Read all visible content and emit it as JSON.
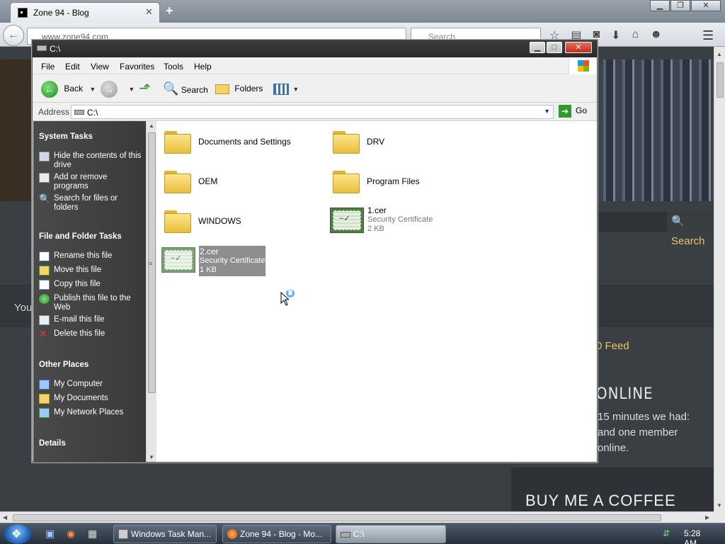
{
  "browser": {
    "tab_title": "Zone 94 - Blog",
    "url": "www.zone94.com",
    "search_placeholder": "Search",
    "window_controls": [
      "minimize",
      "maximize",
      "close"
    ]
  },
  "webpage": {
    "search_button": "Search",
    "you_text": "You",
    "feed_text": "0 Feed",
    "online_heading": "ONLINE",
    "stats_lines": [
      "15 minutes we had:",
      "and one member",
      "online."
    ],
    "coffee_heading": "BUY ME A COFFEE"
  },
  "explorer": {
    "title": "C:\\",
    "menu": [
      "File",
      "Edit",
      "View",
      "Favorites",
      "Tools",
      "Help"
    ],
    "toolbar": {
      "back": "Back",
      "search": "Search",
      "folders": "Folders"
    },
    "address": {
      "label": "Address",
      "value": "C:\\",
      "go": "Go"
    },
    "task_pane": {
      "system_tasks": {
        "heading": "System Tasks",
        "items": [
          "Hide the contents of this drive",
          "Add or remove programs",
          "Search for files or folders"
        ]
      },
      "file_folder_tasks": {
        "heading": "File and Folder Tasks",
        "items": [
          "Rename this file",
          "Move this file",
          "Copy this file",
          "Publish this file to the Web",
          "E-mail this file",
          "Delete this file"
        ]
      },
      "other_places": {
        "heading": "Other Places",
        "items": [
          "My Computer",
          "My Documents",
          "My Network Places"
        ]
      },
      "details": {
        "heading": "Details"
      }
    },
    "files": [
      {
        "name": "Documents and Settings",
        "type": "folder"
      },
      {
        "name": "DRV",
        "type": "folder"
      },
      {
        "name": "OEM",
        "type": "folder"
      },
      {
        "name": "Program Files",
        "type": "folder"
      },
      {
        "name": "WINDOWS",
        "type": "folder"
      },
      {
        "name": "1.cer",
        "type": "certificate",
        "kind": "Security Certificate",
        "size": "2 KB"
      },
      {
        "name": "2.cer",
        "type": "certificate",
        "kind": "Security Certificate",
        "size": "1 KB",
        "selected": true
      }
    ]
  },
  "taskbar": {
    "buttons": [
      "Windows Task Man...",
      "Zone 94 - Blog - Mo...",
      "C:\\"
    ],
    "active_index": 2,
    "clock": "5:28 AM"
  }
}
